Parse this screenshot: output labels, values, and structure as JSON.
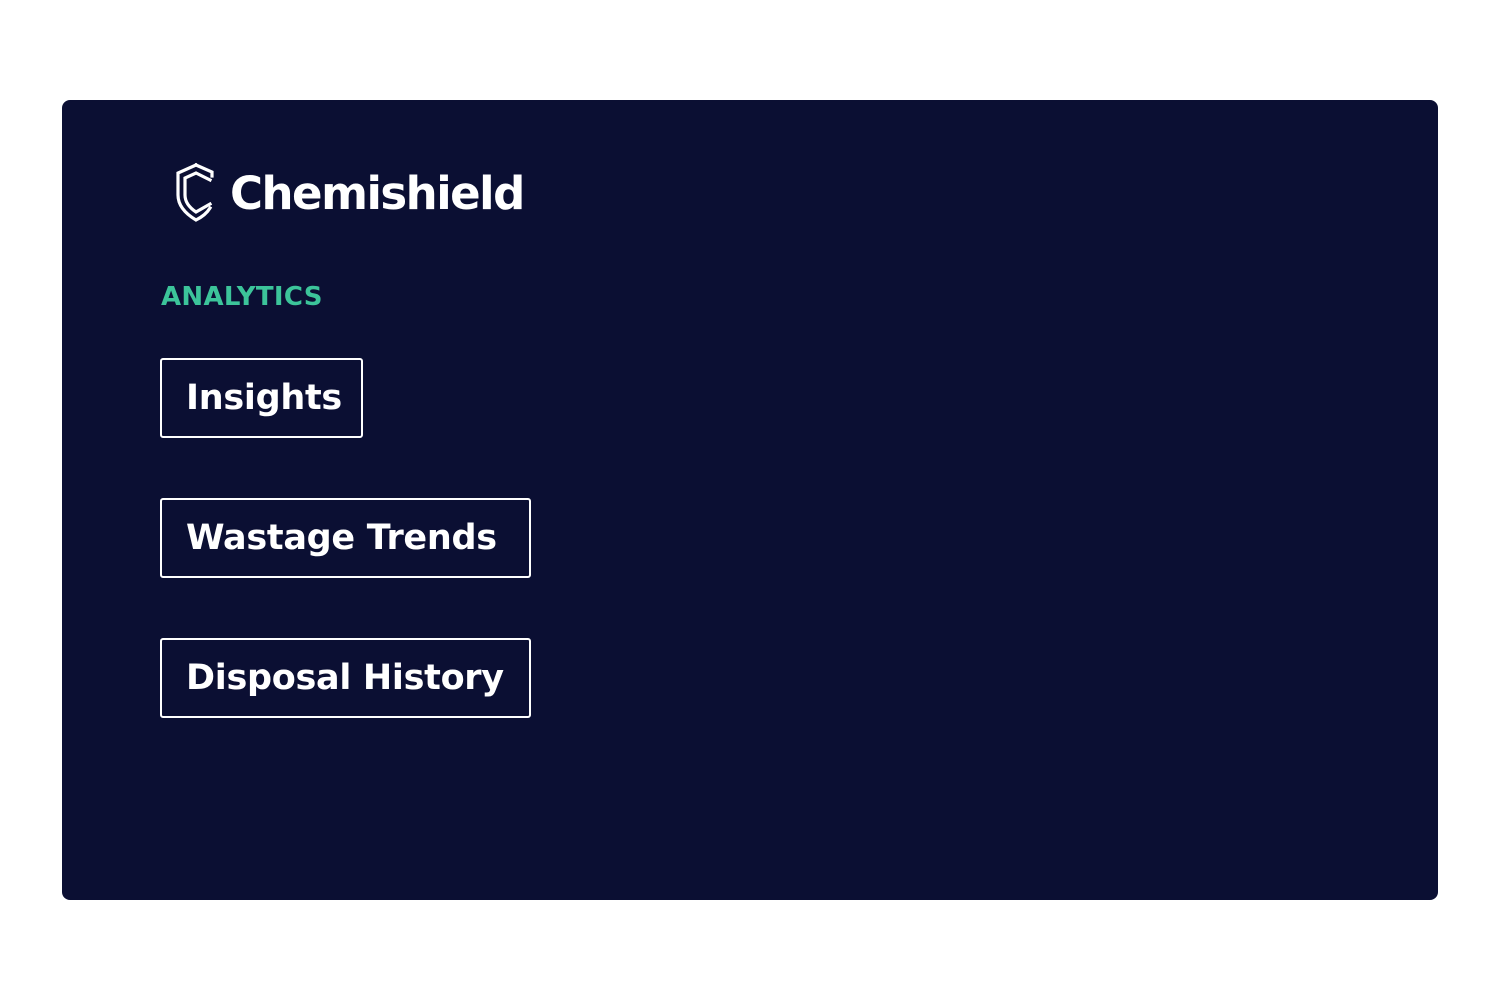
{
  "brand": {
    "name": "Chemishield",
    "icon": "shield-c-logo-icon"
  },
  "analytics": {
    "section_label": "ANALYTICS",
    "items": [
      {
        "label": "Insights"
      },
      {
        "label": "Wastage Trends"
      },
      {
        "label": "Disposal History"
      }
    ]
  },
  "colors": {
    "panel_background": "#0b0f33",
    "page_background": "#ffffff",
    "accent": "#3cc49a",
    "text": "#ffffff"
  }
}
